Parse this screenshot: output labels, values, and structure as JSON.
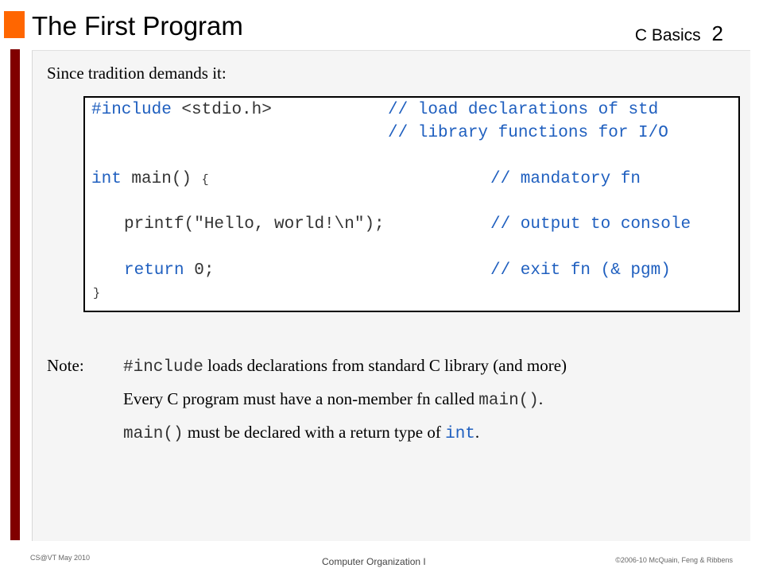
{
  "header": {
    "title": "The First Program",
    "section": "C Basics",
    "slide_number": "2"
  },
  "intro": "Since tradition demands it:",
  "code": {
    "line1_kw": "#include",
    "line1_rest": " <stdio.h>",
    "line1_comment": "// load declarations of std",
    "line2_comment": "// library functions for I/O",
    "line3_kw": "int",
    "line3_rest": " main() ",
    "line3_brace": "{",
    "line3_comment": "// mandatory fn",
    "line4_code": "printf(\"Hello, world!\\n\");",
    "line4_comment": "// output to console",
    "line5_kw": "return",
    "line5_rest": " 0;",
    "line5_comment": "// exit fn (& pgm)",
    "line6_brace": "}"
  },
  "notes": {
    "label": "Note:",
    "n1_code": "#include",
    "n1_text": " loads declarations from standard C library (and more)",
    "n2_text": "Every C program must have a non-member fn called ",
    "n2_code": "main()",
    "n2_end": ".",
    "n3_code": "main()",
    "n3_text": " must be declared with a return type of ",
    "n3_code2": "int",
    "n3_end": "."
  },
  "footer": {
    "left": "CS@VT May 2010",
    "center": "Computer Organization I",
    "right": "©2006-10 McQuain, Feng & Ribbens"
  },
  "colors": {
    "accent": "#ff6600",
    "side_bar": "#800000",
    "code_keyword": "#1f5fbf"
  }
}
